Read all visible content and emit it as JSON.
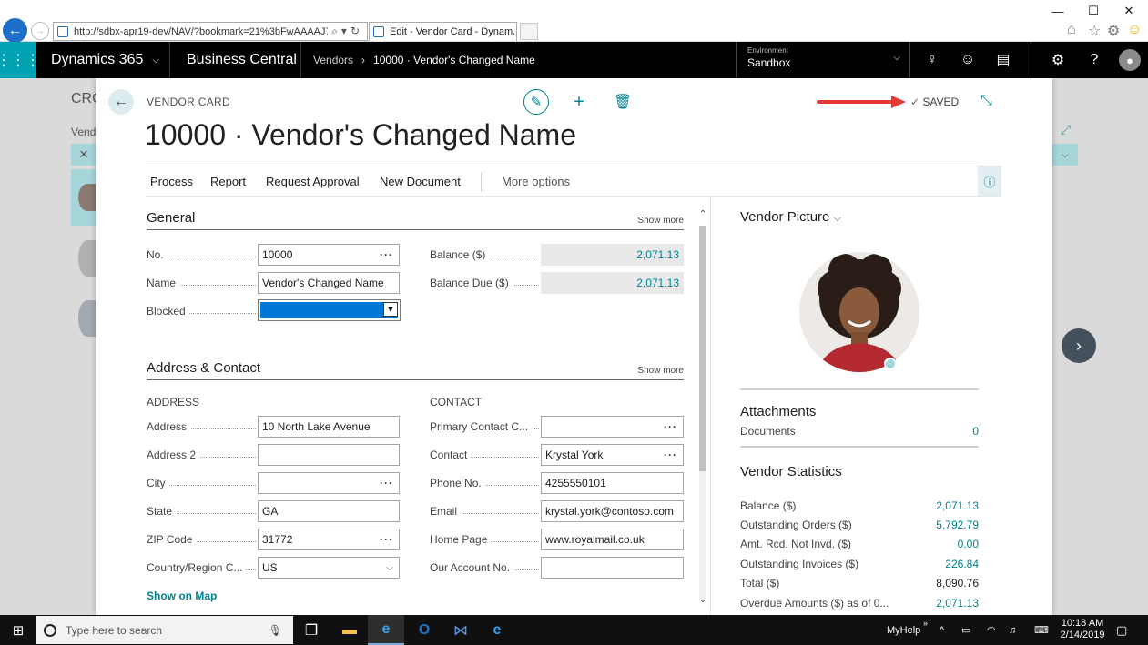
{
  "browser": {
    "url": "http://sdbx-apr19-dev/NAV/?bookmark=21%3bFwAAAAJ7BTE",
    "tab_title": "Edit - Vendor Card - Dynam...",
    "window_controls": {
      "minimize": "—",
      "maximize": "☐",
      "close": "✕"
    }
  },
  "header": {
    "app_name": "Dynamics 365",
    "product": "Business Central",
    "breadcrumb": [
      "Vendors",
      "10000 · Vendor's Changed Name"
    ],
    "environment_label": "Environment",
    "environment_value": "Sandbox"
  },
  "background": {
    "page_title": "CRO",
    "subtitle": "Vend"
  },
  "card": {
    "caption": "VENDOR CARD",
    "title": "10000 · Vendor's Changed Name",
    "status": "SAVED",
    "actions": [
      "Process",
      "Report",
      "Request Approval",
      "New Document"
    ],
    "more_options": "More options",
    "general": {
      "title": "General",
      "show_more": "Show more",
      "fields": {
        "no_label": "No.",
        "no_value": "10000",
        "name_label": "Name",
        "name_value": "Vendor's Changed Name",
        "blocked_label": "Blocked",
        "blocked_value": "",
        "balance_label": "Balance ($)",
        "balance_value": "2,071.13",
        "balance_due_label": "Balance Due ($)",
        "balance_due_value": "2,071.13"
      }
    },
    "address_contact": {
      "title": "Address & Contact",
      "show_more": "Show more",
      "address_group": "ADDRESS",
      "contact_group": "CONTACT",
      "address": [
        {
          "label": "Address",
          "value": "10 North Lake Avenue"
        },
        {
          "label": "Address 2",
          "value": ""
        },
        {
          "label": "City",
          "value": ""
        },
        {
          "label": "State",
          "value": "GA"
        },
        {
          "label": "ZIP Code",
          "value": "31772"
        },
        {
          "label": "Country/Region C...",
          "value": "US"
        }
      ],
      "contact": [
        {
          "label": "Primary Contact C...",
          "value": ""
        },
        {
          "label": "Contact",
          "value": "Krystal York"
        },
        {
          "label": "Phone No.",
          "value": "4255550101"
        },
        {
          "label": "Email",
          "value": "krystal.york@contoso.com"
        },
        {
          "label": "Home Page",
          "value": "www.royalmail.co.uk"
        },
        {
          "label": "Our Account No.",
          "value": ""
        }
      ],
      "show_on_map": "Show on Map"
    }
  },
  "factbox": {
    "picture_title": "Vendor Picture",
    "attachments_title": "Attachments",
    "documents_label": "Documents",
    "documents_value": "0",
    "statistics_title": "Vendor Statistics",
    "statistics": [
      {
        "label": "Balance ($)",
        "value": "2,071.13"
      },
      {
        "label": "Outstanding Orders ($)",
        "value": "5,792.79"
      },
      {
        "label": "Amt. Rcd. Not Invd. ($)",
        "value": "0.00"
      },
      {
        "label": "Outstanding Invoices ($)",
        "value": "226.84"
      },
      {
        "label": "Total ($)",
        "value": "8,090.76"
      },
      {
        "label": "Overdue Amounts ($) as of 0...",
        "value": "2,071.13"
      }
    ]
  },
  "taskbar": {
    "search_placeholder": "Type here to search",
    "myhelp": "MyHelp",
    "time": "10:18 AM",
    "date": "2/14/2019"
  },
  "colors": {
    "accent": "#00838f",
    "waffle": "#00a3b4",
    "header_bg": "#000000",
    "selection": "#0078d7",
    "annotation_arrow": "#e53935"
  }
}
